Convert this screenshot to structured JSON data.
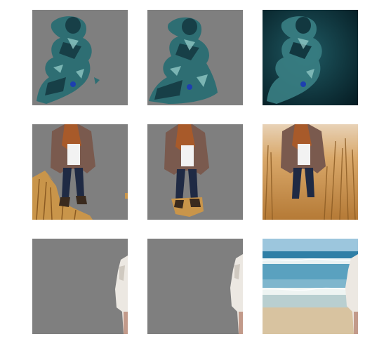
{
  "figure": {
    "rows": [
      {
        "subject": "person-underwater",
        "panels": [
          {
            "kind": "mask-a",
            "background": "gray"
          },
          {
            "kind": "mask-b",
            "background": "gray"
          },
          {
            "kind": "original",
            "background": "dark-teal-water"
          }
        ]
      },
      {
        "subject": "woman-in-dry-grass",
        "panels": [
          {
            "kind": "mask-a",
            "background": "gray"
          },
          {
            "kind": "mask-b",
            "background": "gray"
          },
          {
            "kind": "original",
            "background": "golden-grass-field"
          }
        ]
      },
      {
        "subject": "person-at-beach",
        "panels": [
          {
            "kind": "mask-a",
            "background": "gray"
          },
          {
            "kind": "mask-b",
            "background": "gray"
          },
          {
            "kind": "original",
            "background": "ocean-beach"
          }
        ]
      }
    ],
    "colors": {
      "mask_gray": "#7f7f7f",
      "water_dark": "#0b2a33",
      "grass": "#c9954a",
      "sky": "#9cc6dd",
      "sea": "#2f7fa6",
      "sand": "#d8c3a0"
    }
  }
}
